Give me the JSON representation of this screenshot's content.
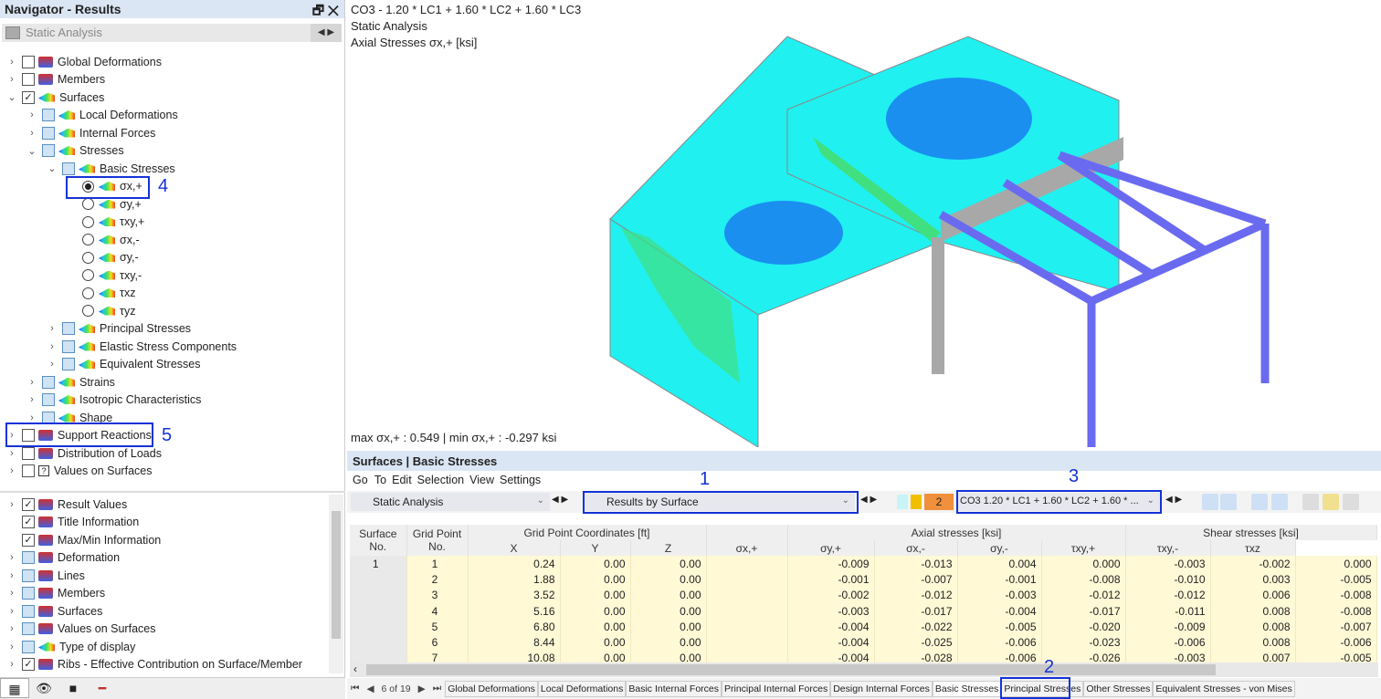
{
  "navigator": {
    "title": "Navigator - Results",
    "title_buttons": [
      "restore-icon",
      "close-icon"
    ],
    "combo": "Static Analysis",
    "tree": [
      {
        "lvl": 0,
        "exp": ">",
        "cb": "box",
        "icon": "red",
        "label": "Global Deformations"
      },
      {
        "lvl": 0,
        "exp": ">",
        "cb": "box",
        "icon": "red",
        "label": "Members"
      },
      {
        "lvl": 0,
        "exp": "v",
        "cb": "checked",
        "icon": "surf",
        "label": "Surfaces"
      },
      {
        "lvl": 1,
        "exp": ">",
        "cb": "light",
        "icon": "surf",
        "label": "Local Deformations"
      },
      {
        "lvl": 1,
        "exp": ">",
        "cb": "light",
        "icon": "surf",
        "label": "Internal Forces"
      },
      {
        "lvl": 1,
        "exp": "v",
        "cb": "light",
        "icon": "surf",
        "label": "Stresses"
      },
      {
        "lvl": 2,
        "exp": "v",
        "cb": "light",
        "icon": "surf",
        "label": "Basic Stresses"
      },
      {
        "lvl": 3,
        "exp": "",
        "cb": "radio-on",
        "icon": "surf",
        "label": "σx,+"
      },
      {
        "lvl": 3,
        "exp": "",
        "cb": "radio",
        "icon": "surf",
        "label": "σy,+"
      },
      {
        "lvl": 3,
        "exp": "",
        "cb": "radio",
        "icon": "surf",
        "label": "τxy,+"
      },
      {
        "lvl": 3,
        "exp": "",
        "cb": "radio",
        "icon": "surf",
        "label": "σx,-"
      },
      {
        "lvl": 3,
        "exp": "",
        "cb": "radio",
        "icon": "surf",
        "label": "σy,-"
      },
      {
        "lvl": 3,
        "exp": "",
        "cb": "radio",
        "icon": "surf",
        "label": "τxy,-"
      },
      {
        "lvl": 3,
        "exp": "",
        "cb": "radio",
        "icon": "surf",
        "label": "τxz"
      },
      {
        "lvl": 3,
        "exp": "",
        "cb": "radio",
        "icon": "surf",
        "label": "τyz"
      },
      {
        "lvl": 2,
        "exp": ">",
        "cb": "light",
        "icon": "surf",
        "label": "Principal Stresses"
      },
      {
        "lvl": 2,
        "exp": ">",
        "cb": "light",
        "icon": "surf",
        "label": "Elastic Stress Components"
      },
      {
        "lvl": 2,
        "exp": ">",
        "cb": "light",
        "icon": "surf",
        "label": "Equivalent Stresses"
      },
      {
        "lvl": 1,
        "exp": ">",
        "cb": "light",
        "icon": "surf",
        "label": "Strains"
      },
      {
        "lvl": 1,
        "exp": ">",
        "cb": "light",
        "icon": "surf",
        "label": "Isotropic Characteristics"
      },
      {
        "lvl": 1,
        "exp": ">",
        "cb": "light",
        "icon": "surf",
        "label": "Shape"
      },
      {
        "lvl": 0,
        "exp": ">",
        "cb": "box",
        "icon": "red",
        "label": "Support Reactions"
      },
      {
        "lvl": 0,
        "exp": ">",
        "cb": "box",
        "icon": "red",
        "label": "Distribution of Loads"
      },
      {
        "lvl": 0,
        "exp": ">",
        "cb": "box",
        "icon": "help",
        "label": "Values on Surfaces"
      }
    ],
    "display_tree": [
      {
        "lvl": 0,
        "exp": ">",
        "cb": "checked",
        "icon": "red",
        "label": "Result Values"
      },
      {
        "lvl": 0,
        "exp": "",
        "cb": "checked",
        "icon": "red",
        "label": "Title Information"
      },
      {
        "lvl": 0,
        "exp": "",
        "cb": "checked",
        "icon": "red",
        "label": "Max/Min Information"
      },
      {
        "lvl": 0,
        "exp": ">",
        "cb": "light",
        "icon": "red",
        "label": "Deformation"
      },
      {
        "lvl": 0,
        "exp": ">",
        "cb": "light",
        "icon": "red",
        "label": "Lines"
      },
      {
        "lvl": 0,
        "exp": ">",
        "cb": "light",
        "icon": "red",
        "label": "Members"
      },
      {
        "lvl": 0,
        "exp": ">",
        "cb": "light",
        "icon": "red",
        "label": "Surfaces"
      },
      {
        "lvl": 0,
        "exp": ">",
        "cb": "light",
        "icon": "red",
        "label": "Values on Surfaces"
      },
      {
        "lvl": 0,
        "exp": ">",
        "cb": "light",
        "icon": "surf",
        "label": "Type of display"
      },
      {
        "lvl": 0,
        "exp": ">",
        "cb": "checked",
        "icon": "red",
        "label": "Ribs - Effective Contribution on Surface/Member"
      }
    ],
    "bottom_tabs": [
      "data-icon",
      "eye-icon",
      "camera-icon",
      "results-icon"
    ]
  },
  "viewport": {
    "line1": "CO3 - 1.20 * LC1 + 1.60 * LC2 + 1.60 * LC3",
    "line2": "Static Analysis",
    "line3": "Axial Stresses σx,+ [ksi]",
    "maxmin": "max σx,+ : 0.549 | min σx,+ : -0.297 ksi",
    "colors": {
      "cyan": "#20f0f0",
      "blue": "#1a8ff0",
      "green": "#40e080",
      "member": "#6a6af0",
      "gray": "#a8a8a8"
    }
  },
  "results": {
    "title": "Surfaces | Basic Stresses",
    "menu": [
      "Go To",
      "Edit",
      "Selection",
      "View",
      "Settings"
    ],
    "analysis": "Static Analysis",
    "mode": "Results by Surface",
    "lc_badge": "2",
    "combo": "CO3  1.20 * LC1 + 1.60 * LC2 + 1.60 * ...",
    "group_headers": [
      "Grid Point Coordinates [ft]",
      "Axial stresses [ksi]",
      "Shear stresses [ksi]"
    ],
    "headers": [
      "Surface No.",
      "Grid Point No.",
      "X",
      "Y",
      "Z",
      "",
      "σx,+",
      "σy,+",
      "σx,-",
      "σy,-",
      "τxy,+",
      "τxy,-",
      "τxz"
    ],
    "rows": [
      [
        "1",
        "1",
        "0.24",
        "0.00",
        "0.00",
        "",
        "-0.009",
        "-0.013",
        "0.004",
        "0.000",
        "-0.003",
        "-0.002",
        "0.000"
      ],
      [
        "",
        "2",
        "1.88",
        "0.00",
        "0.00",
        "",
        "-0.001",
        "-0.007",
        "-0.001",
        "-0.008",
        "-0.010",
        "0.003",
        "-0.005"
      ],
      [
        "",
        "3",
        "3.52",
        "0.00",
        "0.00",
        "",
        "-0.002",
        "-0.012",
        "-0.003",
        "-0.012",
        "-0.012",
        "0.006",
        "-0.008"
      ],
      [
        "",
        "4",
        "5.16",
        "0.00",
        "0.00",
        "",
        "-0.003",
        "-0.017",
        "-0.004",
        "-0.017",
        "-0.011",
        "0.008",
        "-0.008"
      ],
      [
        "",
        "5",
        "6.80",
        "0.00",
        "0.00",
        "",
        "-0.004",
        "-0.022",
        "-0.005",
        "-0.020",
        "-0.009",
        "0.008",
        "-0.007"
      ],
      [
        "",
        "6",
        "8.44",
        "0.00",
        "0.00",
        "",
        "-0.004",
        "-0.025",
        "-0.006",
        "-0.023",
        "-0.006",
        "0.008",
        "-0.006"
      ],
      [
        "",
        "7",
        "10.08",
        "0.00",
        "0.00",
        "",
        "-0.004",
        "-0.028",
        "-0.006",
        "-0.026",
        "-0.003",
        "0.007",
        "-0.005"
      ]
    ],
    "pager": "6 of 19",
    "tabs": [
      "Global Deformations",
      "Local Deformations",
      "Basic Internal Forces",
      "Principal Internal Forces",
      "Design Internal Forces",
      "Basic Stresses",
      "Principal Stresses",
      "Other Stresses",
      "Equivalent Stresses - von Mises"
    ],
    "active_tab": "Basic Stresses"
  },
  "annotations": [
    "1",
    "2",
    "3",
    "4",
    "5"
  ]
}
